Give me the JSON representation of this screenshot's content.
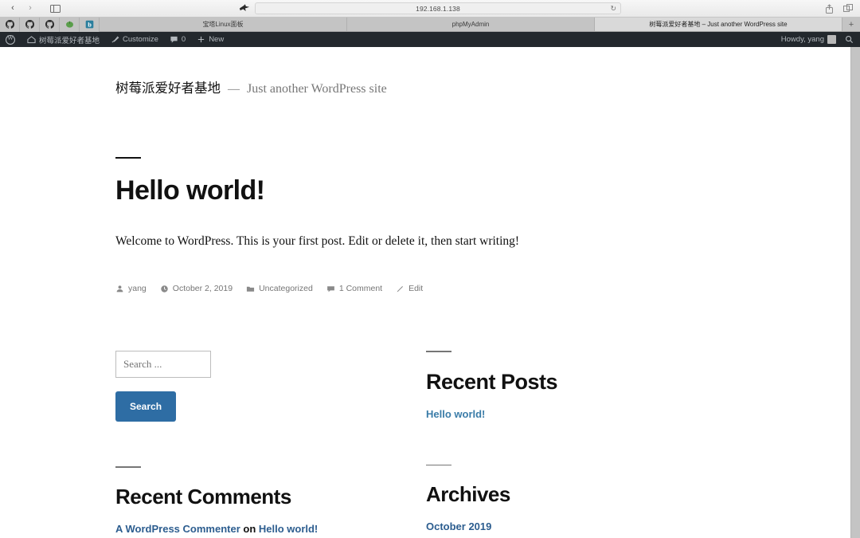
{
  "browser": {
    "back_label": "‹",
    "forward_label": "›",
    "sidebar_name": "sidebar-toggle",
    "address": "192.168.1.138",
    "reload_label": "↻",
    "share_name": "share-icon",
    "tabs_overview_name": "tab-overview-icon",
    "newtab_label": "+",
    "pinned_tabs": [
      {
        "name": "github-pinned-tab-1",
        "glyph": "github"
      },
      {
        "name": "github-pinned-tab-2",
        "glyph": "github"
      },
      {
        "name": "github-pinned-tab-3",
        "glyph": "github"
      },
      {
        "name": "green-pinned-tab",
        "glyph": "green"
      },
      {
        "name": "blue-b-pinned-tab",
        "glyph": "blueb"
      }
    ],
    "tabs": [
      {
        "title": "宝塔Linux面板",
        "active": false
      },
      {
        "title": "phpMyAdmin",
        "active": false
      },
      {
        "title": "树莓派爱好者基地 – Just another WordPress site",
        "active": true
      }
    ]
  },
  "adminbar": {
    "wp_logo": "wordpress-logo",
    "site_name": "树莓派爱好者基地",
    "customize": "Customize",
    "comment_count": "0",
    "new": "New",
    "howdy": "Howdy, yang",
    "search_icon": "search-icon"
  },
  "site": {
    "title": "树莓派爱好者基地",
    "dash": "—",
    "description": "Just another WordPress site"
  },
  "post": {
    "title": "Hello world!",
    "content": "Welcome to WordPress. This is your first post. Edit or delete it, then start writing!",
    "author": "yang",
    "date": "October 2, 2019",
    "category": "Uncategorized",
    "comments": "1 Comment",
    "edit": "Edit"
  },
  "widgets": {
    "search": {
      "placeholder": "Search ...",
      "value": "",
      "button": "Search"
    },
    "recent_posts": {
      "title": "Recent Posts",
      "items": [
        "Hello world!"
      ]
    },
    "recent_comments": {
      "title": "Recent Comments",
      "items": [
        {
          "author": "A WordPress Commenter",
          "on": " on ",
          "post": "Hello world!"
        }
      ]
    },
    "archives": {
      "title": "Archives",
      "items": [
        "October 2019"
      ]
    }
  },
  "colors": {
    "accent_link": "#3a7ca8",
    "button_blue": "#2e6da4",
    "adminbar_bg": "#23282d",
    "text": "#111111",
    "muted": "#767676"
  }
}
